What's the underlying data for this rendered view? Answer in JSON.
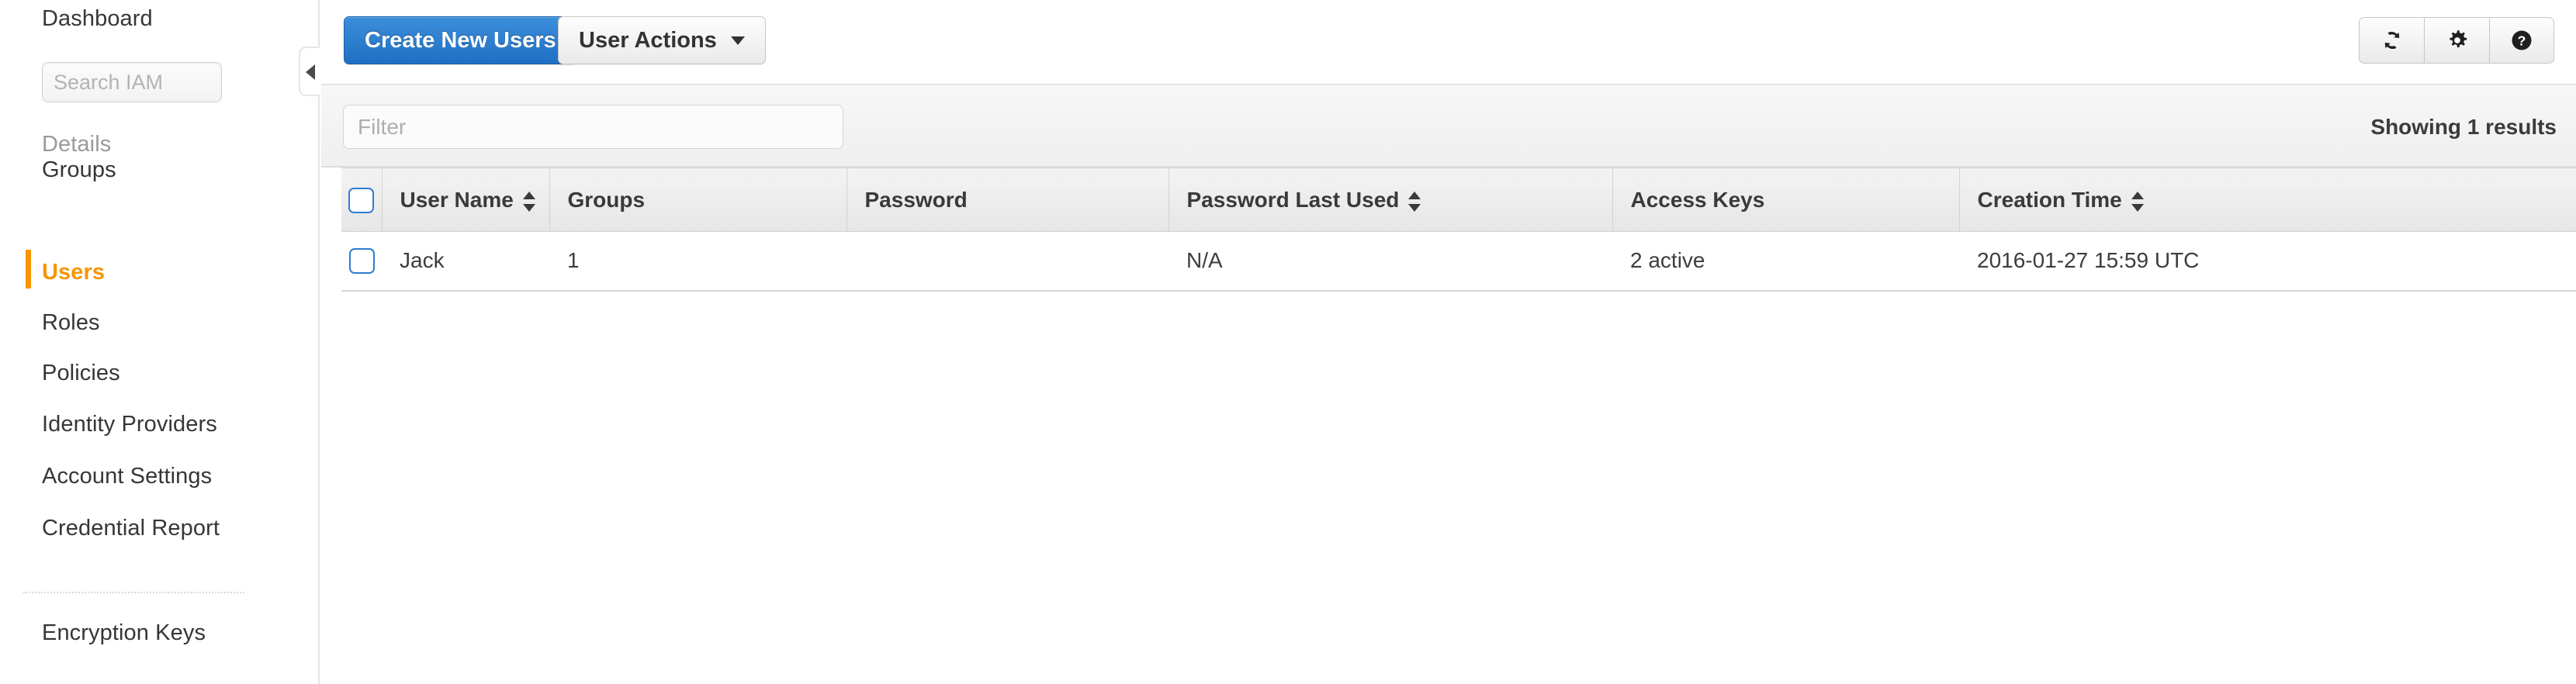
{
  "sidebar": {
    "top_link": {
      "label": "Dashboard"
    },
    "search": {
      "placeholder": "Search IAM",
      "value": ""
    },
    "section_label": "Details",
    "items": [
      {
        "label": "Groups",
        "active": false
      },
      {
        "label": "Users",
        "active": true
      },
      {
        "label": "Roles",
        "active": false
      },
      {
        "label": "Policies",
        "active": false
      },
      {
        "label": "Identity Providers",
        "active": false
      },
      {
        "label": "Account Settings",
        "active": false
      },
      {
        "label": "Credential Report",
        "active": false
      }
    ],
    "footer_items": [
      {
        "label": "Encryption Keys"
      }
    ],
    "collapse_icon": "chevron-left-icon",
    "active_color": "#f79500"
  },
  "toolbar": {
    "create_label": "Create New Users",
    "user_actions_label": "User Actions",
    "create_color": "#2a7dc9",
    "icons": [
      {
        "name": "refresh-icon",
        "title": "Refresh"
      },
      {
        "name": "gear-icon",
        "title": "Settings"
      },
      {
        "name": "help-icon",
        "title": "Help"
      }
    ]
  },
  "filter_bar": {
    "placeholder": "Filter",
    "value": "",
    "showing_results": "Showing 1 results"
  },
  "table": {
    "select_all_checkbox": false,
    "columns": [
      {
        "label": "User Name",
        "sortable": true
      },
      {
        "label": "Groups",
        "sortable": false
      },
      {
        "label": "Password",
        "sortable": false
      },
      {
        "label": "Password Last Used",
        "sortable": true
      },
      {
        "label": "Access Keys",
        "sortable": false
      },
      {
        "label": "Creation Time",
        "sortable": true
      }
    ],
    "rows": [
      {
        "selected": false,
        "user_name": "Jack",
        "groups": "1",
        "password": "",
        "password_last_used": "N/A",
        "access_keys": "2 active",
        "creation_time": "2016-01-27 15:59 UTC"
      }
    ]
  }
}
